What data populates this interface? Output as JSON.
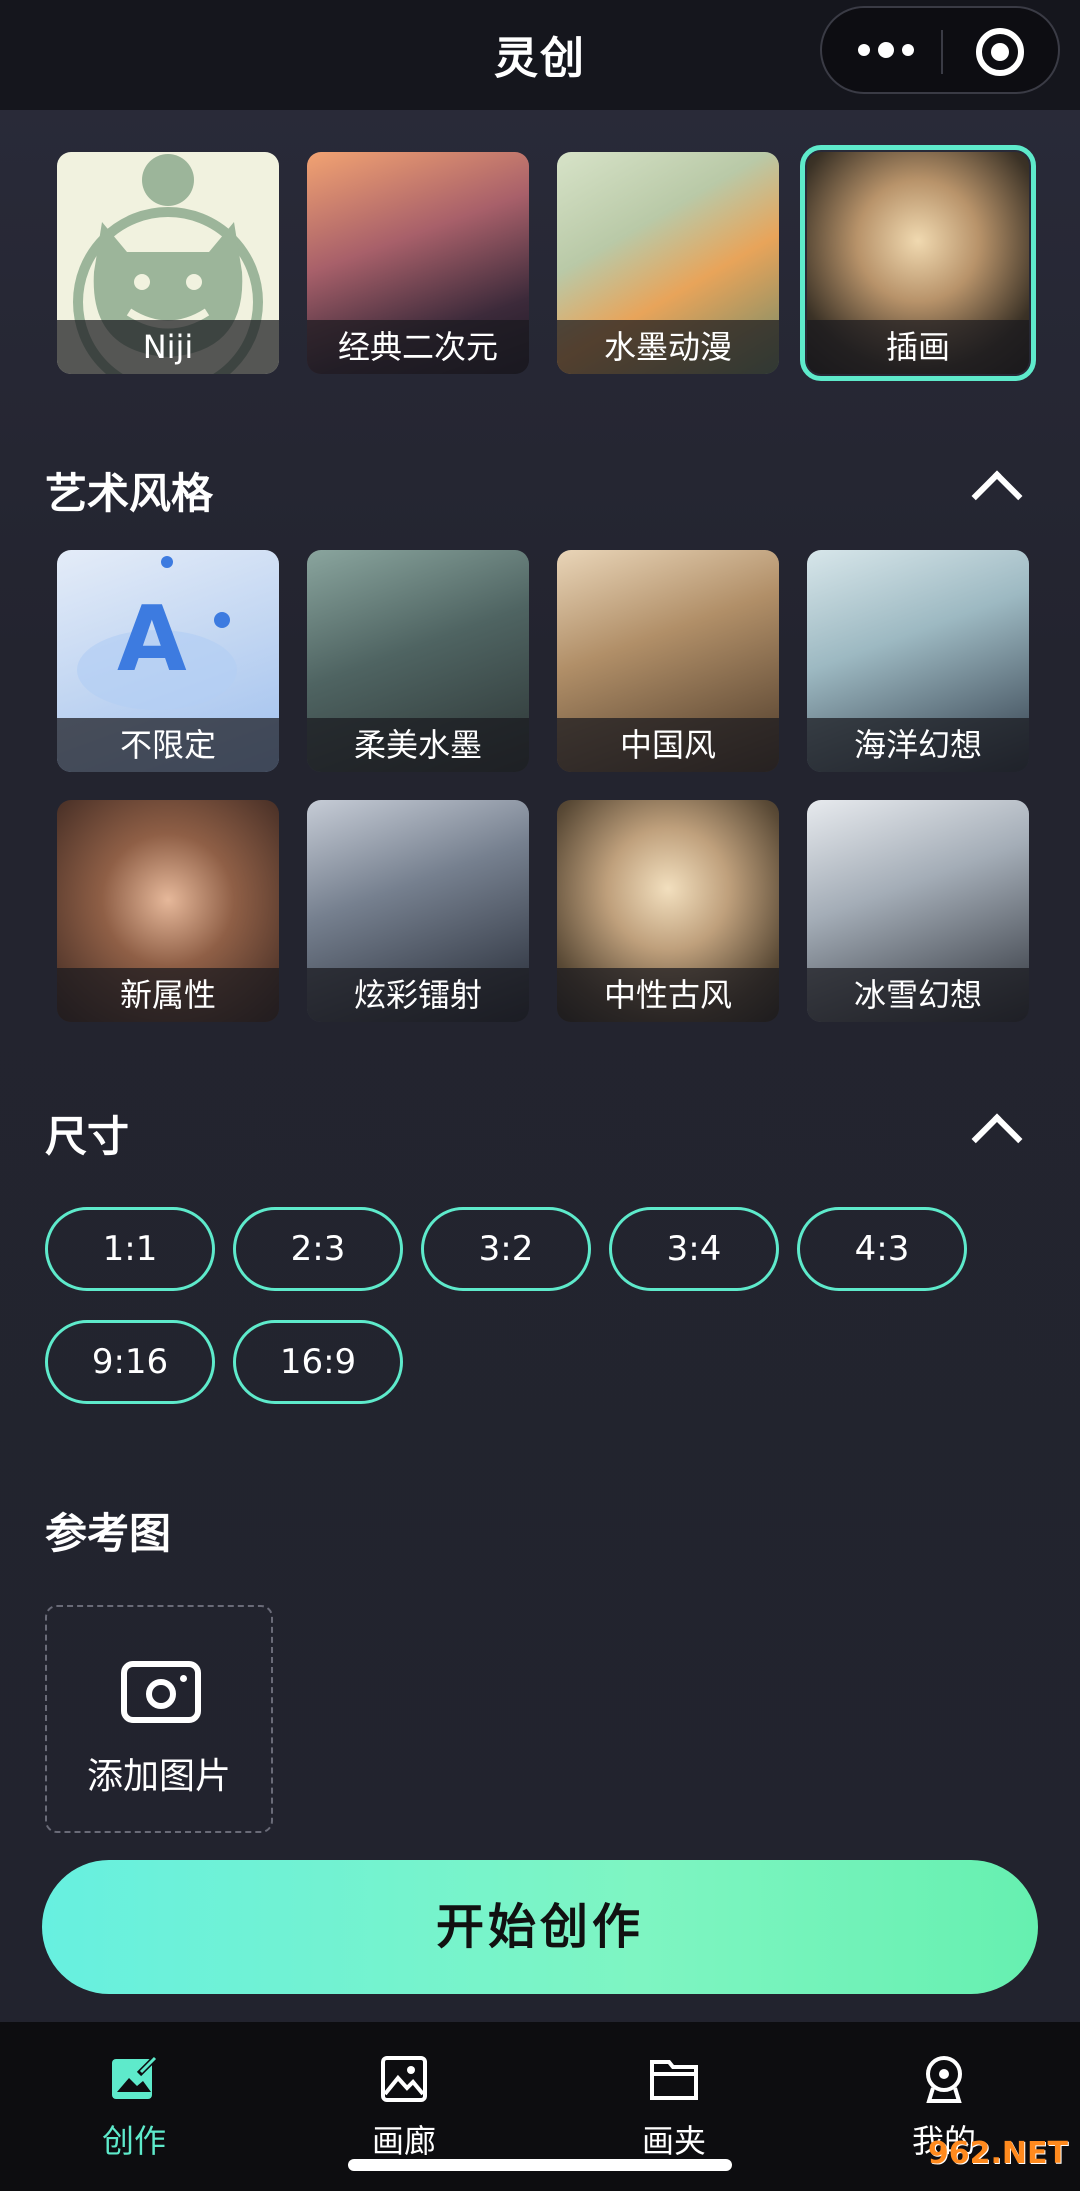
{
  "header": {
    "title": "灵创",
    "menu_icon": "more-dots-icon",
    "close_icon": "target-circle-icon"
  },
  "model_row": [
    {
      "label": "Niji",
      "selected": false
    },
    {
      "label": "经典二次元",
      "selected": false
    },
    {
      "label": "水墨动漫",
      "selected": false
    },
    {
      "label": "插画",
      "selected": true
    }
  ],
  "art_style": {
    "title": "艺术风格",
    "items": [
      "不限定",
      "柔美水墨",
      "中国风",
      "海洋幻想",
      "新属性",
      "炫彩镭射",
      "中性古风",
      "冰雪幻想"
    ]
  },
  "size": {
    "title": "尺寸",
    "options": [
      "1:1",
      "2:3",
      "3:2",
      "3:4",
      "4:3",
      "9:16",
      "16:9"
    ]
  },
  "reference": {
    "title": "参考图",
    "add_label": "添加图片"
  },
  "start_button": "开始创作",
  "nav": [
    {
      "label": "创作",
      "active": true,
      "icon": "create-image-icon"
    },
    {
      "label": "画廊",
      "active": false,
      "icon": "gallery-icon"
    },
    {
      "label": "画夹",
      "active": false,
      "icon": "folder-icon"
    },
    {
      "label": "我的",
      "active": false,
      "icon": "profile-icon"
    }
  ],
  "watermark": "962.NET",
  "colors": {
    "accent": "#5eeacb",
    "background": "#22232f"
  }
}
